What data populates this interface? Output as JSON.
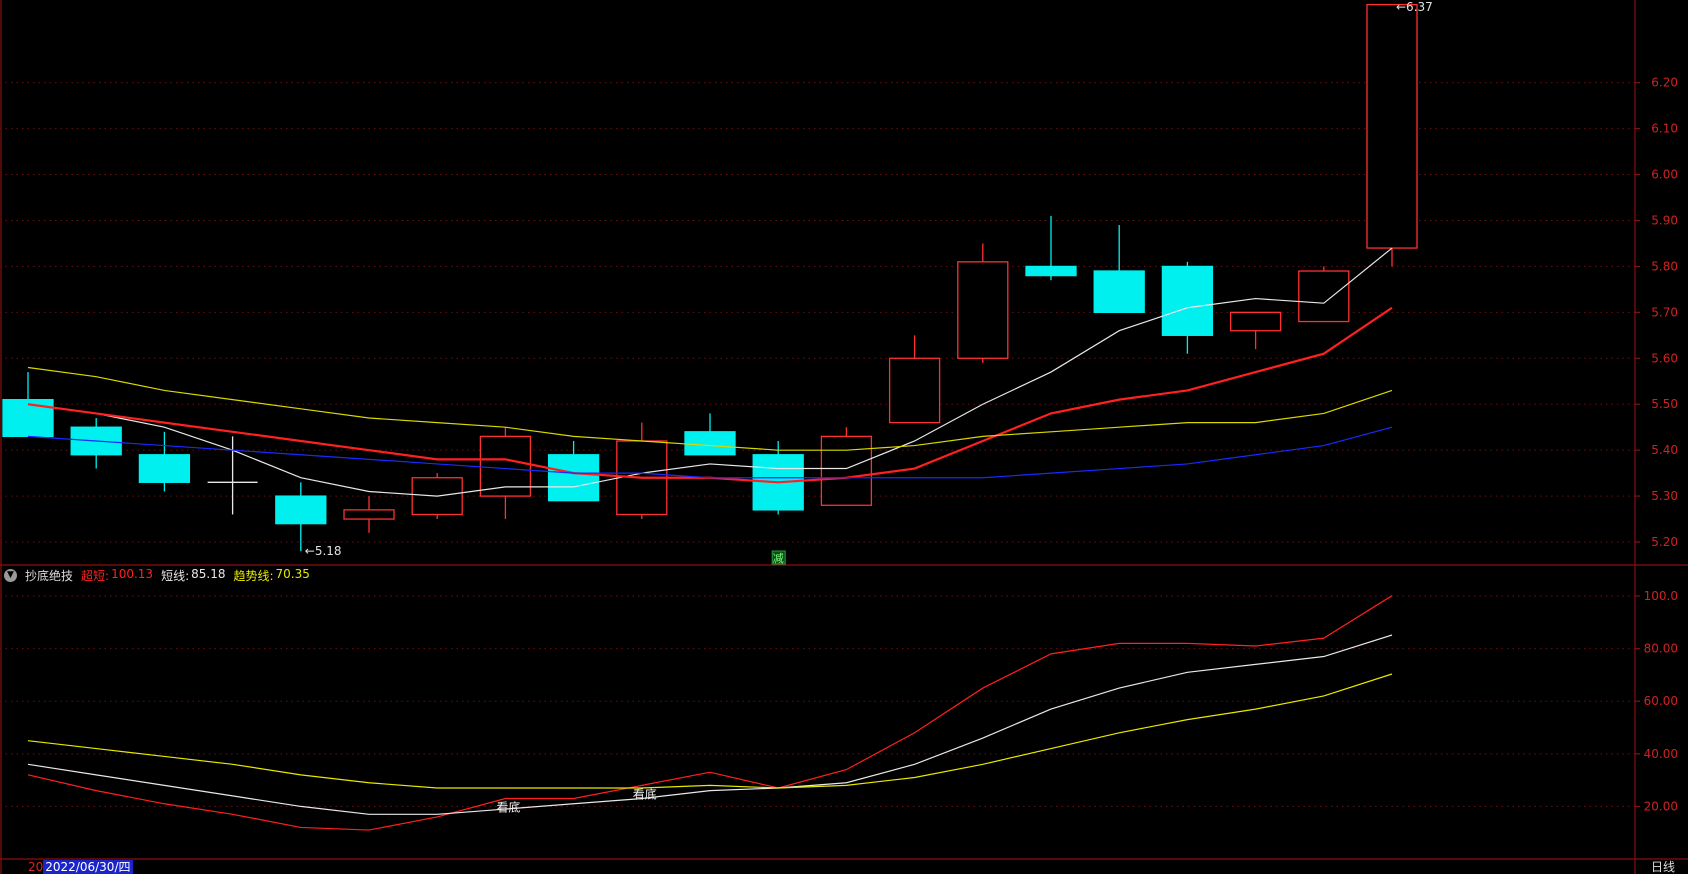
{
  "colors": {
    "up": "#ff3030",
    "down": "#00f0f0",
    "neutral": "#e8e8e8",
    "ma_white": "#e8e8e8",
    "ma_red": "#ff2020",
    "ma_yellow": "#d8d800",
    "ma_blue": "#1a2aff",
    "axis": "#8b0f0f",
    "tick": "#d02222"
  },
  "indicator": {
    "name": "抄底绝技",
    "toggle_icon": "chevron-down-icon",
    "items": [
      {
        "label": "超短:",
        "value": "100.13",
        "color": "#ff2020"
      },
      {
        "label": "短线:",
        "value": "85.18",
        "color": "#e8e8e8"
      },
      {
        "label": "趋势线:",
        "value": "70.35",
        "color": "#e8e800"
      }
    ]
  },
  "status_bar": {
    "date_prefix": "20",
    "date": "2022/06/30/四",
    "period": "日线"
  },
  "chart_data": [
    {
      "type": "candlestick",
      "ylim": [
        5.15,
        6.38
      ],
      "y_ticks": [
        "6.20",
        "6.10",
        "6.00",
        "5.90",
        "5.80",
        "5.70",
        "5.60",
        "5.50",
        "5.40",
        "5.30",
        "5.20"
      ],
      "candles": [
        {
          "o": 5.51,
          "h": 5.57,
          "l": 5.43,
          "c": 5.43
        },
        {
          "o": 5.45,
          "h": 5.47,
          "l": 5.36,
          "c": 5.39
        },
        {
          "o": 5.39,
          "h": 5.44,
          "l": 5.31,
          "c": 5.33
        },
        {
          "o": 5.33,
          "h": 5.43,
          "l": 5.26,
          "c": 5.33
        },
        {
          "o": 5.3,
          "h": 5.33,
          "l": 5.18,
          "c": 5.24
        },
        {
          "o": 5.25,
          "h": 5.3,
          "l": 5.22,
          "c": 5.27
        },
        {
          "o": 5.26,
          "h": 5.35,
          "l": 5.25,
          "c": 5.34
        },
        {
          "o": 5.3,
          "h": 5.45,
          "l": 5.25,
          "c": 5.43
        },
        {
          "o": 5.39,
          "h": 5.42,
          "l": 5.29,
          "c": 5.29
        },
        {
          "o": 5.26,
          "h": 5.46,
          "l": 5.25,
          "c": 5.42
        },
        {
          "o": 5.44,
          "h": 5.48,
          "l": 5.39,
          "c": 5.39
        },
        {
          "o": 5.39,
          "h": 5.42,
          "l": 5.26,
          "c": 5.27
        },
        {
          "o": 5.28,
          "h": 5.45,
          "l": 5.28,
          "c": 5.43
        },
        {
          "o": 5.46,
          "h": 5.65,
          "l": 5.46,
          "c": 5.6
        },
        {
          "o": 5.6,
          "h": 5.85,
          "l": 5.59,
          "c": 5.81
        },
        {
          "o": 5.8,
          "h": 5.91,
          "l": 5.77,
          "c": 5.78
        },
        {
          "o": 5.79,
          "h": 5.89,
          "l": 5.7,
          "c": 5.7
        },
        {
          "o": 5.8,
          "h": 5.81,
          "l": 5.61,
          "c": 5.65
        },
        {
          "o": 5.66,
          "h": 5.7,
          "l": 5.62,
          "c": 5.7
        },
        {
          "o": 5.68,
          "h": 5.8,
          "l": 5.68,
          "c": 5.79
        },
        {
          "o": 5.84,
          "h": 6.37,
          "l": 5.8,
          "c": 6.37
        }
      ],
      "ma_series": [
        {
          "color": "ma_white",
          "values": [
            5.5,
            5.48,
            5.45,
            5.4,
            5.34,
            5.31,
            5.3,
            5.32,
            5.32,
            5.35,
            5.37,
            5.36,
            5.36,
            5.42,
            5.5,
            5.57,
            5.66,
            5.71,
            5.73,
            5.72,
            5.84
          ]
        },
        {
          "color": "ma_red",
          "values": [
            5.5,
            5.48,
            5.46,
            5.44,
            5.42,
            5.4,
            5.38,
            5.38,
            5.35,
            5.34,
            5.34,
            5.33,
            5.34,
            5.36,
            5.42,
            5.48,
            5.51,
            5.53,
            5.57,
            5.61,
            5.71
          ]
        },
        {
          "color": "ma_yellow",
          "values": [
            5.58,
            5.56,
            5.53,
            5.51,
            5.49,
            5.47,
            5.46,
            5.45,
            5.43,
            5.42,
            5.41,
            5.4,
            5.4,
            5.41,
            5.43,
            5.44,
            5.45,
            5.46,
            5.46,
            5.48,
            5.53
          ]
        },
        {
          "color": "ma_blue",
          "values": [
            5.43,
            5.42,
            5.41,
            5.4,
            5.39,
            5.38,
            5.37,
            5.36,
            5.35,
            5.35,
            5.34,
            5.34,
            5.34,
            5.34,
            5.34,
            5.35,
            5.36,
            5.37,
            5.39,
            5.41,
            5.45
          ]
        }
      ],
      "annotations": [
        {
          "label": "5.18",
          "index": 4,
          "value": 5.18,
          "prefix": "←"
        },
        {
          "label": "6.37",
          "index": 20,
          "value": 6.37,
          "prefix": "←"
        },
        {
          "label": "减",
          "index": 11,
          "marker": "bottom"
        }
      ]
    },
    {
      "type": "line",
      "ylim": [
        0,
        108
      ],
      "y_ticks": [
        "100.0",
        "80.00",
        "60.00",
        "40.00",
        "20.00"
      ],
      "series": [
        {
          "name": "超短",
          "color": "#ff2020",
          "values": [
            32,
            26,
            21,
            17,
            12,
            11,
            16,
            23,
            23,
            28,
            33,
            27,
            34,
            48,
            65,
            78,
            82,
            82,
            81,
            84,
            100.13
          ]
        },
        {
          "name": "短线",
          "color": "#e8e8e8",
          "values": [
            36,
            32,
            28,
            24,
            20,
            17,
            17,
            19,
            21,
            23,
            26,
            27,
            29,
            36,
            46,
            57,
            65,
            71,
            74,
            77,
            85.18
          ]
        },
        {
          "name": "趋势线",
          "color": "#e8e800",
          "values": [
            45,
            42,
            39,
            36,
            32,
            29,
            27,
            27,
            27,
            27,
            28,
            27,
            28,
            31,
            36,
            42,
            48,
            53,
            57,
            62,
            70.35
          ]
        }
      ],
      "annotations": [
        {
          "label": "看底",
          "index": 7,
          "value": 20
        },
        {
          "label": "看底",
          "index": 9,
          "value": 25
        }
      ]
    }
  ]
}
